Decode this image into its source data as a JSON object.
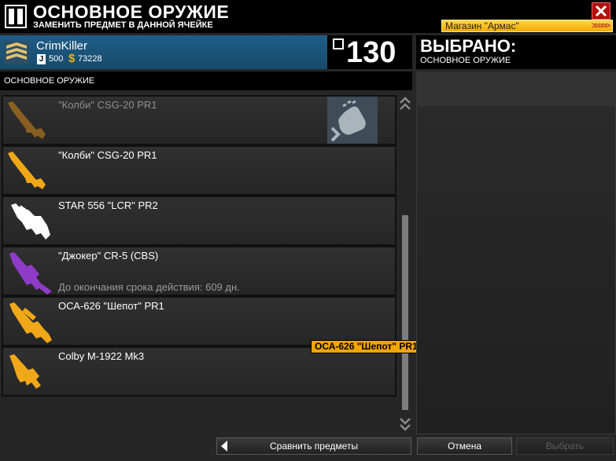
{
  "header": {
    "title": "ОСНОВНОЕ ОРУЖИЕ",
    "subtitle": "ЗАМЕНИТЬ ПРЕДМЕТ В ДАННОЙ ЯЧЕЙКЕ",
    "shop_label": "Магазин \"Армас\"",
    "shop_arrows": ">>>>>"
  },
  "player": {
    "name": "CrimKiller",
    "j_label": "J",
    "j_points": "500",
    "currency_symbol": "$",
    "credits": "73228",
    "level": "130"
  },
  "section_label": "ОСНОВНОЕ ОРУЖИЕ",
  "weapons": [
    {
      "name": "\"Колби\" CSG-20 PR1",
      "extra": "",
      "color": "#c8821c"
    },
    {
      "name": "\"Колби\" CSG-20 PR1",
      "extra": "",
      "color": "#f0a818"
    },
    {
      "name": "STAR 556 \"LCR\" PR2",
      "extra": "",
      "color": "#ffffff"
    },
    {
      "name": "\"Джокер\" CR-5 (CBS)",
      "extra": "До окончания срока действия: 609 дн.",
      "color": "#8e3cc8"
    },
    {
      "name": "ОСА-626 \"Шепот\" PR1",
      "extra": "",
      "color": "#f0a818"
    },
    {
      "name": "Colby M-1922 Mk3",
      "extra": "",
      "color": "#f0a818"
    }
  ],
  "tooltip": "ОСА-626 \"Шепот\" PR1",
  "selected": {
    "title": "ВЫБРАНО:",
    "subtitle": "ОСНОВНОЕ ОРУЖИЕ"
  },
  "buttons": {
    "compare": "Сравнить предметы",
    "cancel": "Отмена",
    "choose": "Выбрать"
  },
  "colors": {
    "accent_blue": "#1f5d86",
    "shop_yellow": "#f5a800",
    "close_red": "#b30f0f",
    "tooltip_orange": "#f0a500"
  }
}
